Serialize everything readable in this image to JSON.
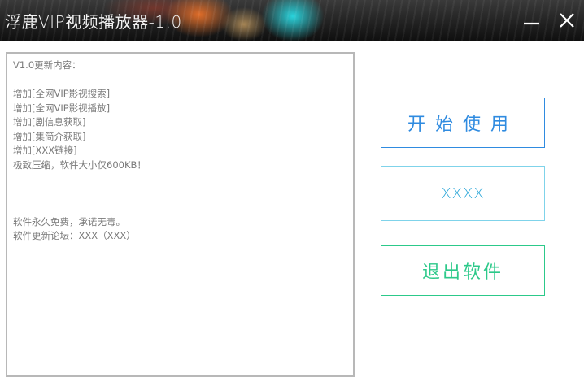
{
  "window": {
    "title": "浮鹿VIP视频播放器-1.0",
    "minimize_icon": "minimize-icon",
    "close_icon": "close-icon"
  },
  "notes": {
    "lines": [
      "V1.0更新内容：",
      "",
      "增加[全网VIP影视搜索]",
      "增加[全网VIP影视播放]",
      "增加[剧信息获取]",
      "增加[集简介获取]",
      "增加[XXX链接]",
      "极致压缩，软件大小仅600KB！",
      "",
      "",
      "",
      "软件永久免费，承诺无毒。",
      "软件更新论坛：XXX（XXX）"
    ]
  },
  "buttons": {
    "start": "开始使用",
    "xxxx": "XXXX",
    "exit": "退出软件"
  },
  "colors": {
    "start": "#2f8be0",
    "xxxx": "#2aa6d8",
    "exit": "#2cc98a",
    "notes_text": "#7a7a7a"
  }
}
